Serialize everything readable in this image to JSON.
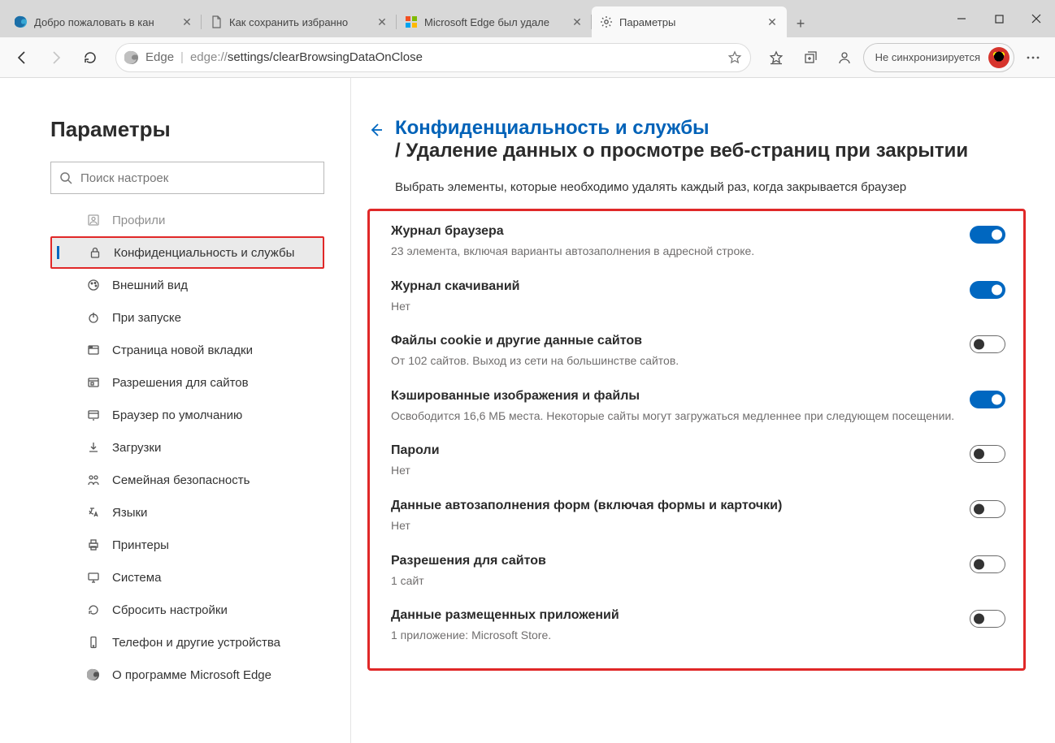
{
  "tabs": [
    {
      "label": "Добро пожаловать в кан"
    },
    {
      "label": "Как сохранить избранно"
    },
    {
      "label": "Microsoft Edge был удале"
    },
    {
      "label": "Параметры"
    }
  ],
  "toolbar": {
    "edge_label": "Edge",
    "url_prefix": "edge://",
    "url_path": "settings/clearBrowsingDataOnClose",
    "sync_label": "Не синхронизируется"
  },
  "sidebar": {
    "title": "Параметры",
    "search_placeholder": "Поиск настроек",
    "items": [
      {
        "label": "Профили"
      },
      {
        "label": "Конфиденциальность и службы"
      },
      {
        "label": "Внешний вид"
      },
      {
        "label": "При запуске"
      },
      {
        "label": "Страница новой вкладки"
      },
      {
        "label": "Разрешения для сайтов"
      },
      {
        "label": "Браузер по умолчанию"
      },
      {
        "label": "Загрузки"
      },
      {
        "label": "Семейная безопасность"
      },
      {
        "label": "Языки"
      },
      {
        "label": "Принтеры"
      },
      {
        "label": "Система"
      },
      {
        "label": "Сбросить настройки"
      },
      {
        "label": "Телефон и другие устройства"
      },
      {
        "label": "О программе Microsoft Edge"
      }
    ]
  },
  "crumb": {
    "parent": "Конфиденциальность и службы",
    "slash": "/",
    "child": "Удаление данных о просмотре веб-страниц при закрытии"
  },
  "description": "Выбрать элементы, которые необходимо удалять каждый раз, когда закрывается браузер",
  "settings": [
    {
      "title": "Журнал браузера",
      "sub": "23 элемента, включая варианты автозаполнения в адресной строке.",
      "on": true
    },
    {
      "title": "Журнал скачиваний",
      "sub": "Нет",
      "on": true
    },
    {
      "title": "Файлы cookie и другие данные сайтов",
      "sub": "От 102 сайтов. Выход из сети на большинстве сайтов.",
      "on": false
    },
    {
      "title": "Кэшированные изображения и файлы",
      "sub": "Освободится 16,6 МБ места. Некоторые сайты могут загружаться медленнее при следующем посещении.",
      "on": true
    },
    {
      "title": "Пароли",
      "sub": "Нет",
      "on": false
    },
    {
      "title": "Данные автозаполнения форм (включая формы и карточки)",
      "sub": "Нет",
      "on": false
    },
    {
      "title": "Разрешения для сайтов",
      "sub": "1 сайт",
      "on": false
    },
    {
      "title": "Данные размещенных приложений",
      "sub": "1 приложение: Microsoft Store.",
      "on": false
    }
  ]
}
